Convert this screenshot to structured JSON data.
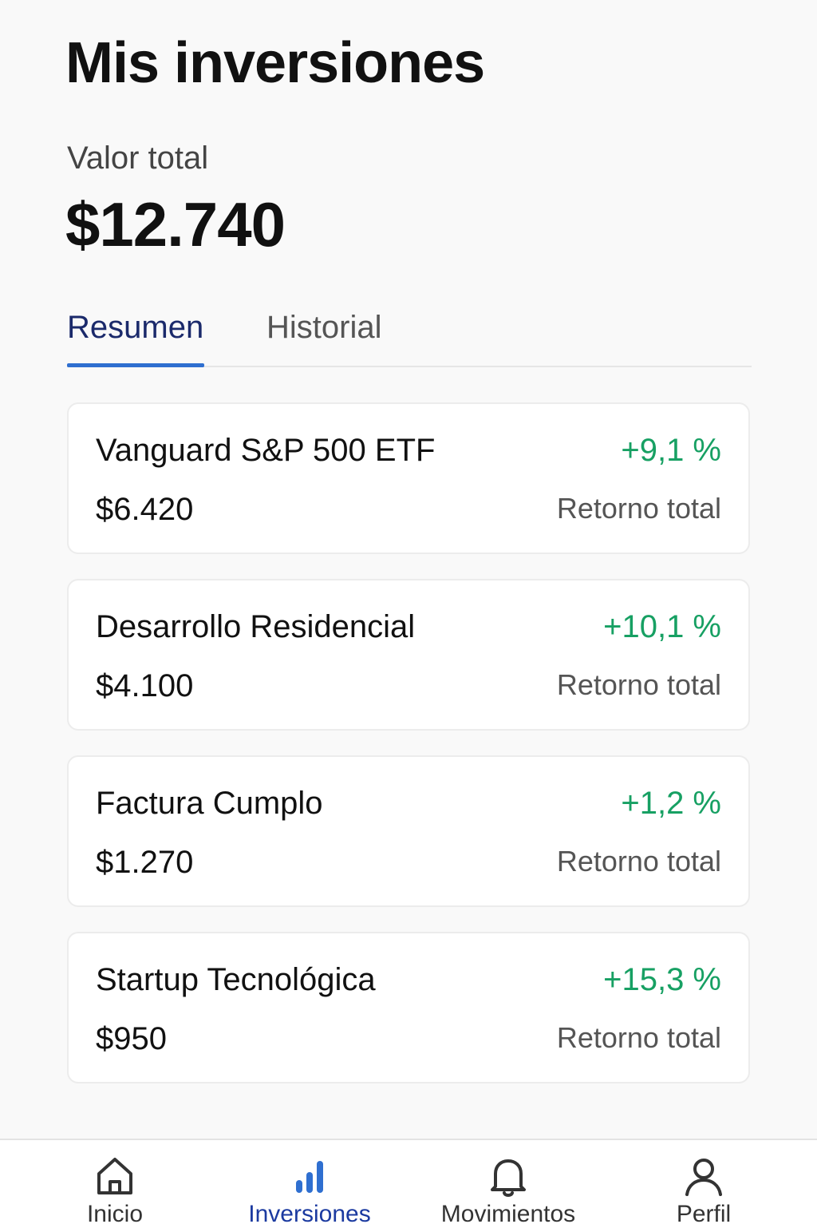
{
  "header": {
    "title": "Mis inversiones",
    "total_label": "Valor total",
    "total_value": "$12.740"
  },
  "tabs": [
    {
      "label": "Resumen",
      "active": true
    },
    {
      "label": "Historial",
      "active": false
    }
  ],
  "investments": [
    {
      "name": "Vanguard S&P 500 ETF",
      "amount": "$6.420",
      "return": "+9,1 %",
      "return_label": "Retorno total"
    },
    {
      "name": "Desarrollo Residencial",
      "amount": "$4.100",
      "return": "+10,1 %",
      "return_label": "Retorno total"
    },
    {
      "name": "Factura Cumplo",
      "amount": "$1.270",
      "return": "+1,2 %",
      "return_label": "Retorno total"
    },
    {
      "name": "Startup Tecnológica",
      "amount": "$950",
      "return": "+15,3 %",
      "return_label": "Retorno total"
    }
  ],
  "bottom_nav": [
    {
      "label": "Inicio",
      "icon": "home-icon",
      "active": false
    },
    {
      "label": "Inversiones",
      "icon": "bar-chart-icon",
      "active": true
    },
    {
      "label": "Movimientos",
      "icon": "bell-icon",
      "active": false
    },
    {
      "label": "Perfil",
      "icon": "user-icon",
      "active": false
    }
  ],
  "colors": {
    "positive": "#17a063",
    "accent": "#2f6fd0",
    "active_nav": "#1b3aa0"
  }
}
